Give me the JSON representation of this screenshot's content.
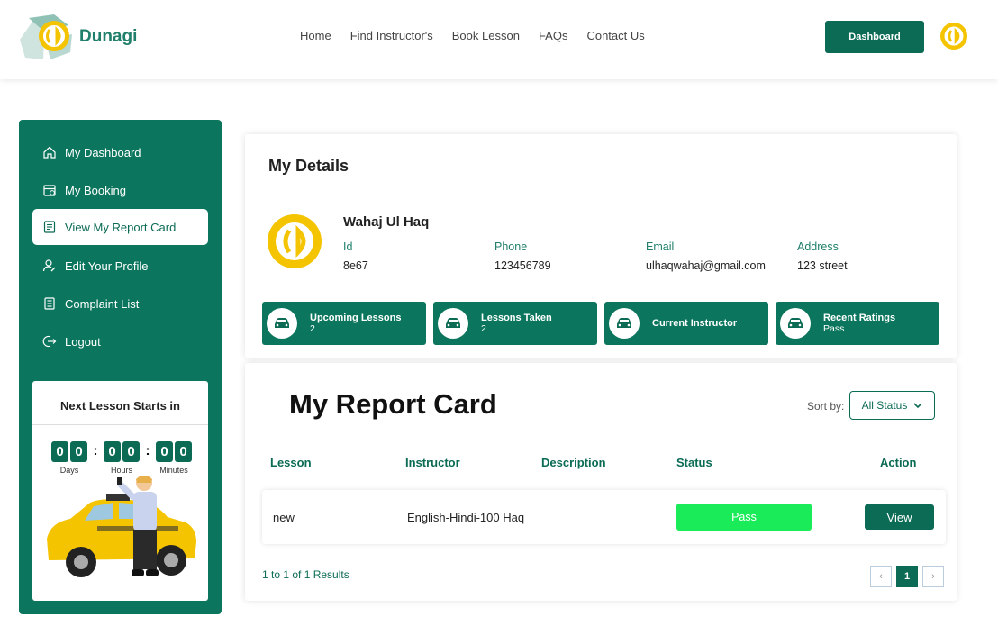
{
  "brand": {
    "name": "Dunagi",
    "accent": "#0b6b55",
    "logo_yellow": "#f4c400"
  },
  "nav": {
    "items": [
      "Home",
      "Find Instructor's",
      "Book Lesson",
      "FAQs",
      "Contact Us"
    ]
  },
  "header": {
    "dashboard_label": "Dashboard"
  },
  "sidebar": {
    "items": [
      {
        "label": "My Dashboard",
        "icon": "home-icon"
      },
      {
        "label": "My Booking",
        "icon": "calendar-icon"
      },
      {
        "label": "View My Report Card",
        "icon": "report-icon",
        "active": true
      },
      {
        "label": "Edit Your Profile",
        "icon": "user-edit-icon"
      },
      {
        "label": "Complaint List",
        "icon": "list-icon"
      },
      {
        "label": "Logout",
        "icon": "logout-icon"
      }
    ]
  },
  "countdown": {
    "title": "Next Lesson Starts in",
    "days": [
      "0",
      "0"
    ],
    "hours": [
      "0",
      "0"
    ],
    "minutes": [
      "0",
      "0"
    ],
    "days_label": "Days",
    "hours_label": "Hours",
    "minutes_label": "Minutes"
  },
  "details": {
    "title": "My Details",
    "name": "Wahaj Ul Haq",
    "id_label": "Id",
    "id": "8e67",
    "phone_label": "Phone",
    "phone": "123456789",
    "email_label": "Email",
    "email": "ulhaqwahaj@gmail.com",
    "address_label": "Address",
    "address": "123 street",
    "stats": [
      {
        "title": "Upcoming Lessons",
        "value": "2"
      },
      {
        "title": "Lessons Taken",
        "value": "2"
      },
      {
        "title": "Current Instructor",
        "value": ""
      },
      {
        "title": "Recent Ratings",
        "value": "Pass"
      }
    ]
  },
  "report": {
    "title": "My Report Card",
    "sort_label": "Sort by:",
    "sort_value": "All Status",
    "columns": [
      "Lesson",
      "Instructor",
      "Description",
      "Status",
      "Action"
    ],
    "rows": [
      {
        "lesson": "new",
        "instructor": "English-Hindi-100 Haq",
        "description": "",
        "status": "Pass",
        "action": "View"
      }
    ],
    "results_text": "1 to 1 of 1 Results",
    "pager": {
      "prev": "‹",
      "page": "1",
      "next": "›"
    }
  }
}
